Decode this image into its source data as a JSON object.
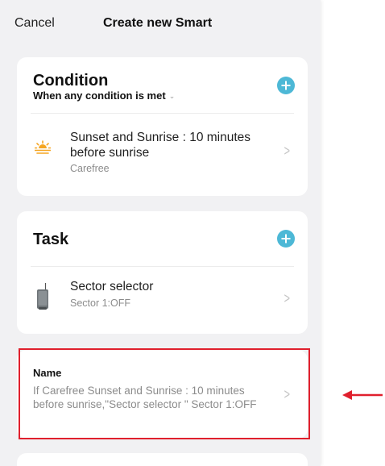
{
  "header": {
    "cancel_label": "Cancel",
    "title": "Create new Smart"
  },
  "condition_section": {
    "title": "Condition",
    "subtitle": "When any condition is met",
    "caret_icon": "chevron-down-icon",
    "add_icon": "plus-circle-icon",
    "items": [
      {
        "icon": "sunrise-icon",
        "title": "Sunset and Sunrise : 10 minutes before sunrise",
        "subtitle": "Carefree"
      }
    ]
  },
  "task_section": {
    "title": "Task",
    "add_icon": "plus-circle-icon",
    "items": [
      {
        "icon": "sector-selector-device-icon",
        "title": "Sector selector",
        "subtitle": "Sector 1:OFF"
      }
    ]
  },
  "name_section": {
    "label": "Name",
    "value": "If Carefree Sunset and Sunrise : 10 minutes before sunrise,\"Sector selector \" Sector 1:OFF"
  },
  "annotation": {
    "highlight_color": "#e0202d",
    "arrow_color": "#e0202d"
  },
  "colors": {
    "accent": "#4db8d6",
    "sun": "#f5a623",
    "background": "#f1f1f3"
  }
}
